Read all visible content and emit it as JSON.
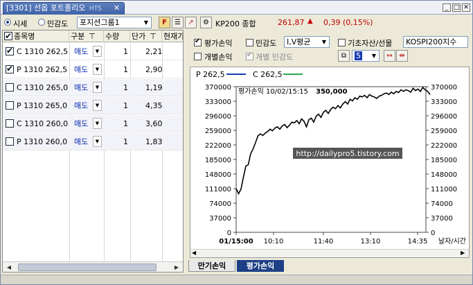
{
  "window": {
    "tab_title": "[3301] 선옵 포트폴리오",
    "tab_tag": "HTS"
  },
  "toolbar": {
    "radio_market": "시세",
    "radio_sensitivity": "민감도",
    "portfolio_group": "포지션그룹1",
    "index_label": "KP200 종합",
    "index_value": "261,87",
    "index_change": "0,39 (0,15%)",
    "up_color": "#c00000"
  },
  "grid": {
    "headers": [
      "종목명",
      "구분",
      "수량",
      "단가",
      "현재가"
    ],
    "rows": [
      {
        "checked": true,
        "name": "C 1310 262,5",
        "side": "매도",
        "qty": "1",
        "price": "2,21"
      },
      {
        "checked": true,
        "name": "P 1310 262,5",
        "side": "매도",
        "qty": "1",
        "price": "2,90"
      },
      {
        "checked": false,
        "name": "C 1310 265,0",
        "side": "매도",
        "qty": "1",
        "price": "1,19"
      },
      {
        "checked": false,
        "name": "P 1310 265,0",
        "side": "매도",
        "qty": "1",
        "price": "4,35"
      },
      {
        "checked": false,
        "name": "C 1310 260,0",
        "side": "매도",
        "qty": "1",
        "price": "3,60"
      },
      {
        "checked": false,
        "name": "P 1310 260,0",
        "side": "매도",
        "qty": "1",
        "price": "1,83"
      }
    ]
  },
  "options": {
    "valuation_pl": "평가손익",
    "sensitivity": "민감도",
    "iv_select": "I,V평균",
    "underlying": "기초자산/선물",
    "underlying_value": "KOSPI200지수",
    "individual_pl": "개별손익",
    "individual_sensitivity": "개별 민감도",
    "number_box": "5"
  },
  "chart_legend": {
    "series_p": "P 262,5",
    "series_c": "C 262,5",
    "color_p": "#1a3db3",
    "color_c": "#2aa84a"
  },
  "chart_data": {
    "type": "line",
    "title": "평가손익 10/02/15:15",
    "title_value": "350,000",
    "x_ticks": [
      "01/15:00",
      "10:10",
      "11:40",
      "13:10",
      "14:35"
    ],
    "xlabel": "날자/시간",
    "ylim": [
      0,
      370000
    ],
    "y_ticks": [
      "370000",
      "333000",
      "296000",
      "259000",
      "222000",
      "185000",
      "148000",
      "111000",
      "74000",
      "37000",
      "0"
    ],
    "watermark": "http://dailypro5.tistory.com",
    "values": [
      111000,
      98000,
      110000,
      140000,
      168000,
      172000,
      200000,
      212000,
      228000,
      245000,
      250000,
      246000,
      252000,
      256000,
      262000,
      258000,
      265000,
      268000,
      262000,
      270000,
      274000,
      266000,
      272000,
      280000,
      278000,
      284000,
      276000,
      288000,
      282000,
      268000,
      286000,
      290000,
      280000,
      295000,
      300000,
      292000,
      305000,
      310000,
      302000,
      312000,
      318000,
      314000,
      322000,
      316000,
      326000,
      332000,
      326000,
      338000,
      334000,
      342000,
      338000,
      346000,
      344000,
      348000,
      342000,
      350000,
      346000,
      344000,
      340000,
      346000,
      348000,
      352000,
      354000,
      350000,
      356000,
      352000,
      358000,
      355000,
      362000,
      358000,
      362000,
      360000,
      356000,
      366000,
      360000,
      364000,
      358000,
      368000,
      362000,
      358000,
      350000
    ]
  },
  "bottom_tabs": {
    "expiry_pl": "만기손익",
    "valuation_pl": "평가손익"
  }
}
